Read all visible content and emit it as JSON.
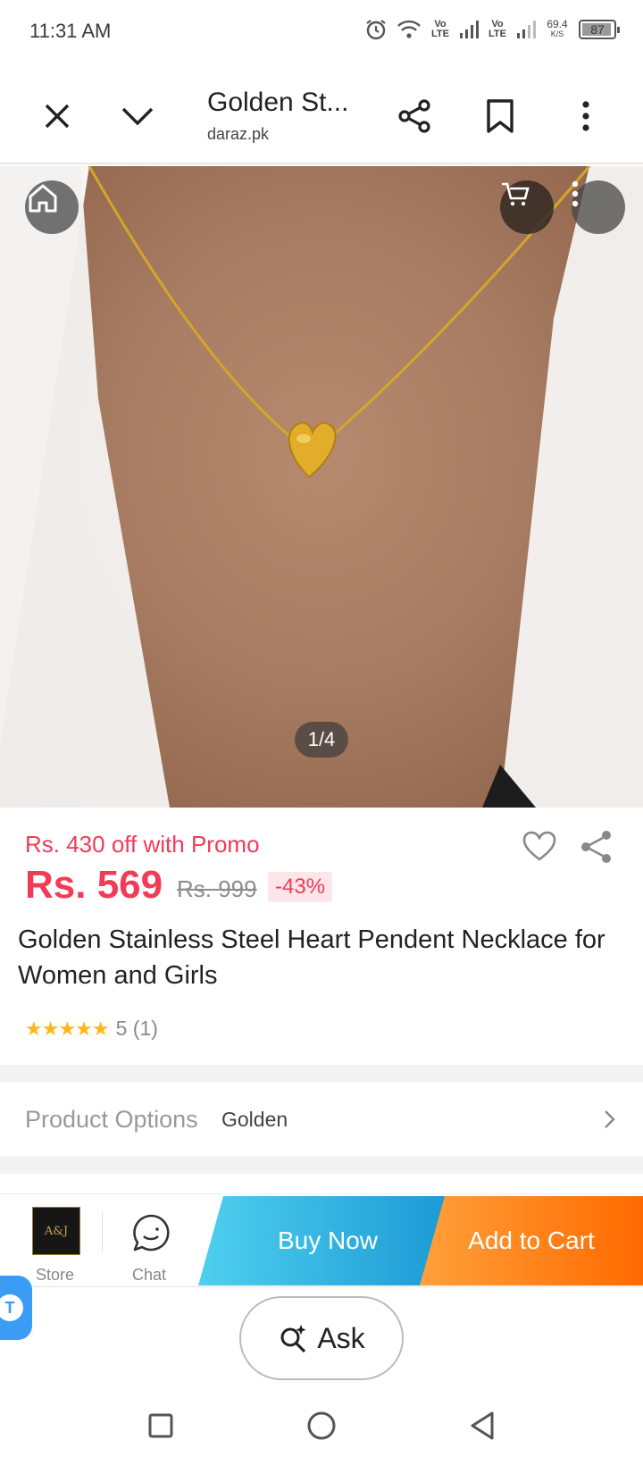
{
  "status": {
    "time": "11:31 AM",
    "net1": "Vo LTE",
    "net2": "Vo LTE",
    "speed_value": "69.4",
    "speed_unit": "K/S",
    "battery": "87"
  },
  "browser": {
    "title": "Golden St...",
    "domain": "daraz.pk"
  },
  "gallery": {
    "page_indicator": "1/4"
  },
  "product": {
    "promo": "Rs. 430 off with Promo",
    "price": "Rs. 569",
    "old_price": "Rs. 999",
    "discount": "-43%",
    "name": "Golden Stainless Steel Heart Pendent Necklace for Women and Girls",
    "stars": "★★★★★",
    "rating_text": "5 (1)",
    "rating_value": 5
  },
  "options": {
    "label": "Product Options",
    "value": "Golden"
  },
  "actions": {
    "store_label": "Store",
    "store_logo_text": "A&J",
    "chat_label": "Chat",
    "buy_now": "Buy Now",
    "add_to_cart": "Add to Cart"
  },
  "ask": {
    "label": "Ask"
  },
  "float_tab": {
    "letter": "T"
  },
  "colors": {
    "accent_red": "#f23b57",
    "buy_blue": "#1a98d4",
    "cart_orange": "#ff6a00",
    "star_yellow": "#f9b81e"
  }
}
